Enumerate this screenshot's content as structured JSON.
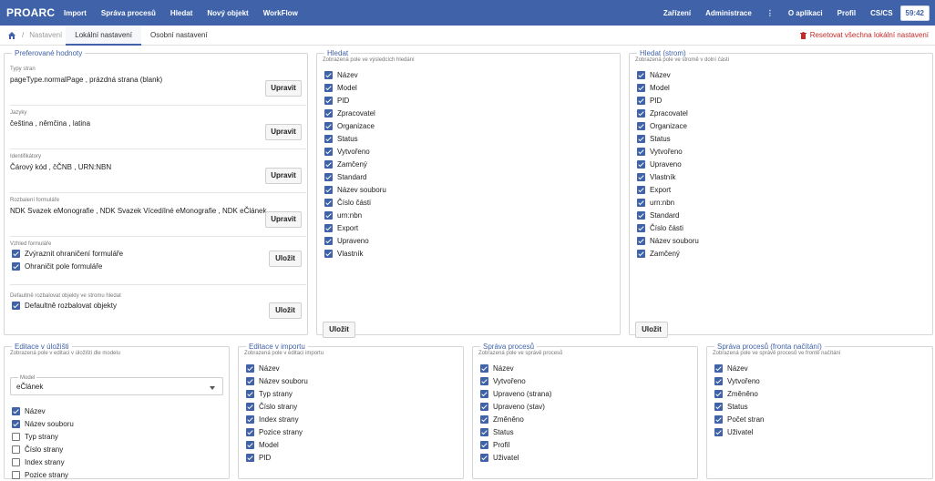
{
  "app": {
    "logo_pro": "PRO",
    "logo_arc": "ARC"
  },
  "nav": [
    "Import",
    "Správa procesů",
    "Hledat",
    "Nový objekt",
    "WorkFlow"
  ],
  "right_nav": [
    "Zařízení",
    "Administrace",
    "⋮",
    "O aplikaci",
    "Profil",
    "CS/CS"
  ],
  "clock": "59:42",
  "breadcrumb": {
    "settings": "Nastavení",
    "tab_local": "Lokální nastavení",
    "tab_personal": "Osobní nastavení"
  },
  "reset_label": "Resetovat všechna lokální nastavení",
  "pref": {
    "title": "Preferované hodnoty",
    "sections": [
      {
        "label": "Typy stran",
        "value": "pageType.normalPage , prázdná strana (blank)",
        "button": "Upravit"
      },
      {
        "label": "Jazyky",
        "value": "čeština , němčina , latina",
        "button": "Upravit"
      },
      {
        "label": "Identifikátory",
        "value": "Čárový kód , čČNB , URN:NBN",
        "button": "Upravit"
      },
      {
        "label": "Rozbalení formuláře",
        "value": "NDK Svazek eMonografie , NDK Svazek Vícedílné eMonografie , NDK eČlánek",
        "button": "Upravit"
      }
    ],
    "form_view": {
      "label": "Vzhled formuláře",
      "items": [
        "Zvýraznit ohraničení formuláře",
        "Ohraničit pole formuláře"
      ],
      "button": "Uložit"
    },
    "tree": {
      "label": "Defaultně rozbalovat objekty ve stromu hledat",
      "items": [
        "Defaultně rozbalovat objekty"
      ],
      "button": "Uložit"
    }
  },
  "search": {
    "title": "Hledat",
    "desc": "Zobrazená pole ve výsledcích hledání",
    "items": [
      "Název",
      "Model",
      "PID",
      "Zpracovatel",
      "Organizace",
      "Status",
      "Vytvořeno",
      "Zamčený",
      "Standard",
      "Název souboru",
      "Číslo části",
      "urn:nbn",
      "Export",
      "Upraveno",
      "Vlastník"
    ],
    "button": "Uložit"
  },
  "search_tree": {
    "title": "Hledat (strom)",
    "desc": "Zobrazená pole ve stromě v dolní části",
    "items": [
      "Název",
      "Model",
      "PID",
      "Zpracovatel",
      "Organizace",
      "Status",
      "Vytvořeno",
      "Upraveno",
      "Vlastník",
      "Export",
      "urn:nbn",
      "Standard",
      "Číslo části",
      "Název souboru",
      "Zamčený"
    ],
    "button": "Uložit"
  },
  "storage": {
    "title": "Editace v úložišti",
    "desc": "Zobrazená pole v editaci v úložišti dle modelu",
    "model_label": "Model",
    "model_value": "eČlánek",
    "items": [
      {
        "t": "Název",
        "c": true
      },
      {
        "t": "Název souboru",
        "c": true
      },
      {
        "t": "Typ strany",
        "c": false
      },
      {
        "t": "Číslo strany",
        "c": false
      },
      {
        "t": "Index strany",
        "c": false
      },
      {
        "t": "Pozice strany",
        "c": false
      }
    ]
  },
  "import_edit": {
    "title": "Editace v importu",
    "desc": "Zobrazená pole v editaci importu",
    "items": [
      "Název",
      "Název souboru",
      "Typ strany",
      "Číslo strany",
      "Index strany",
      "Pozice strany",
      "Model",
      "PID"
    ]
  },
  "process": {
    "title": "Správa procesů",
    "desc": "Zobrazená pole ve správě procesů",
    "items": [
      "Název",
      "Vytvořeno",
      "Upraveno (strana)",
      "Upraveno (stav)",
      "Změněno",
      "Status",
      "Profil",
      "Uživatel"
    ]
  },
  "queue": {
    "title": "Správa procesů (fronta načítání)",
    "desc": "Zobrazená pole ve správě procesů ve frontě načítání",
    "items": [
      "Název",
      "Vytvořeno",
      "Změněno",
      "Status",
      "Počet stran",
      "Uživatel"
    ]
  }
}
